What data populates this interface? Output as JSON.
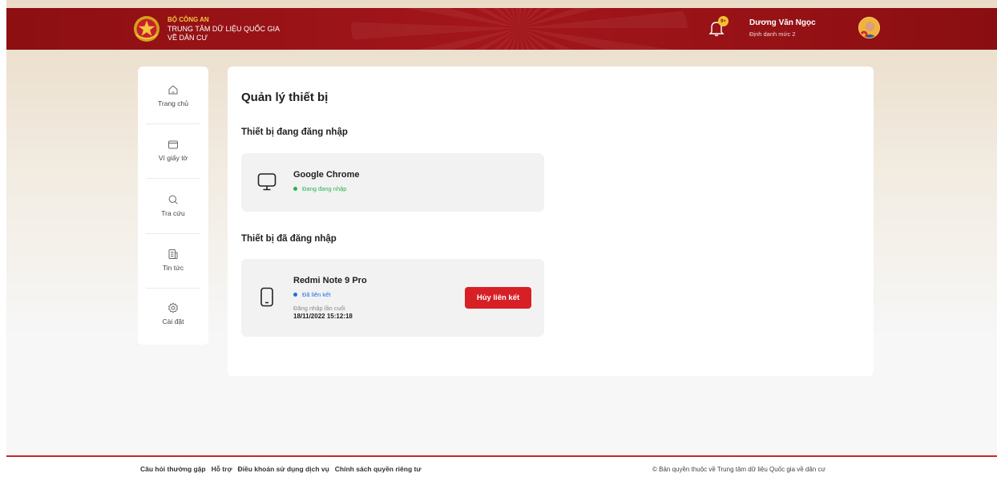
{
  "header": {
    "ministry": "BỘ CÔNG AN",
    "center_line1": "TRUNG TÂM DỮ LIỆU QUỐC GIA",
    "center_line2": "VỀ DÂN CƯ",
    "notification_badge": "9+",
    "user_name": "Dương Văn Ngọc",
    "user_role": "Định danh mức 2"
  },
  "sidebar": {
    "items": [
      {
        "label": "Trang chủ",
        "icon": "home-icon"
      },
      {
        "label": "Ví giấy tờ",
        "icon": "wallet-icon"
      },
      {
        "label": "Tra cứu",
        "icon": "search-icon"
      },
      {
        "label": "Tin tức",
        "icon": "news-icon"
      },
      {
        "label": "Cài đặt",
        "icon": "settings-icon"
      }
    ]
  },
  "main": {
    "title": "Quản lý thiết bị",
    "current_section": "Thiết bị đang đăng nhập",
    "current_device": {
      "name": "Google Chrome",
      "status": "Đang đang nhập",
      "icon": "monitor-icon"
    },
    "linked_section": "Thiết bị đã đăng nhập",
    "linked_device": {
      "name": "Redmi Note 9 Pro",
      "status": "Đã liên kết",
      "last_login_label": "Đăng nhập lần cuối",
      "last_login_time": "18/11/2022 15:12:18",
      "unlink_label": "Hủy liên kết",
      "icon": "phone-icon"
    }
  },
  "footer": {
    "links": [
      "Câu hỏi thường gặp",
      "Hỗ trợ",
      "Điều khoản sử dụng dịch vụ",
      "Chính sách quyền riêng tư"
    ],
    "copyright": "© Bản quyền thuộc về Trung tâm dữ liệu Quốc gia về dân cư"
  },
  "colors": {
    "header_red": "#8d0f12",
    "accent_gold": "#f5c542",
    "button_red": "#d71f26",
    "status_green": "#2ab24a",
    "status_blue": "#1f6fe0"
  }
}
